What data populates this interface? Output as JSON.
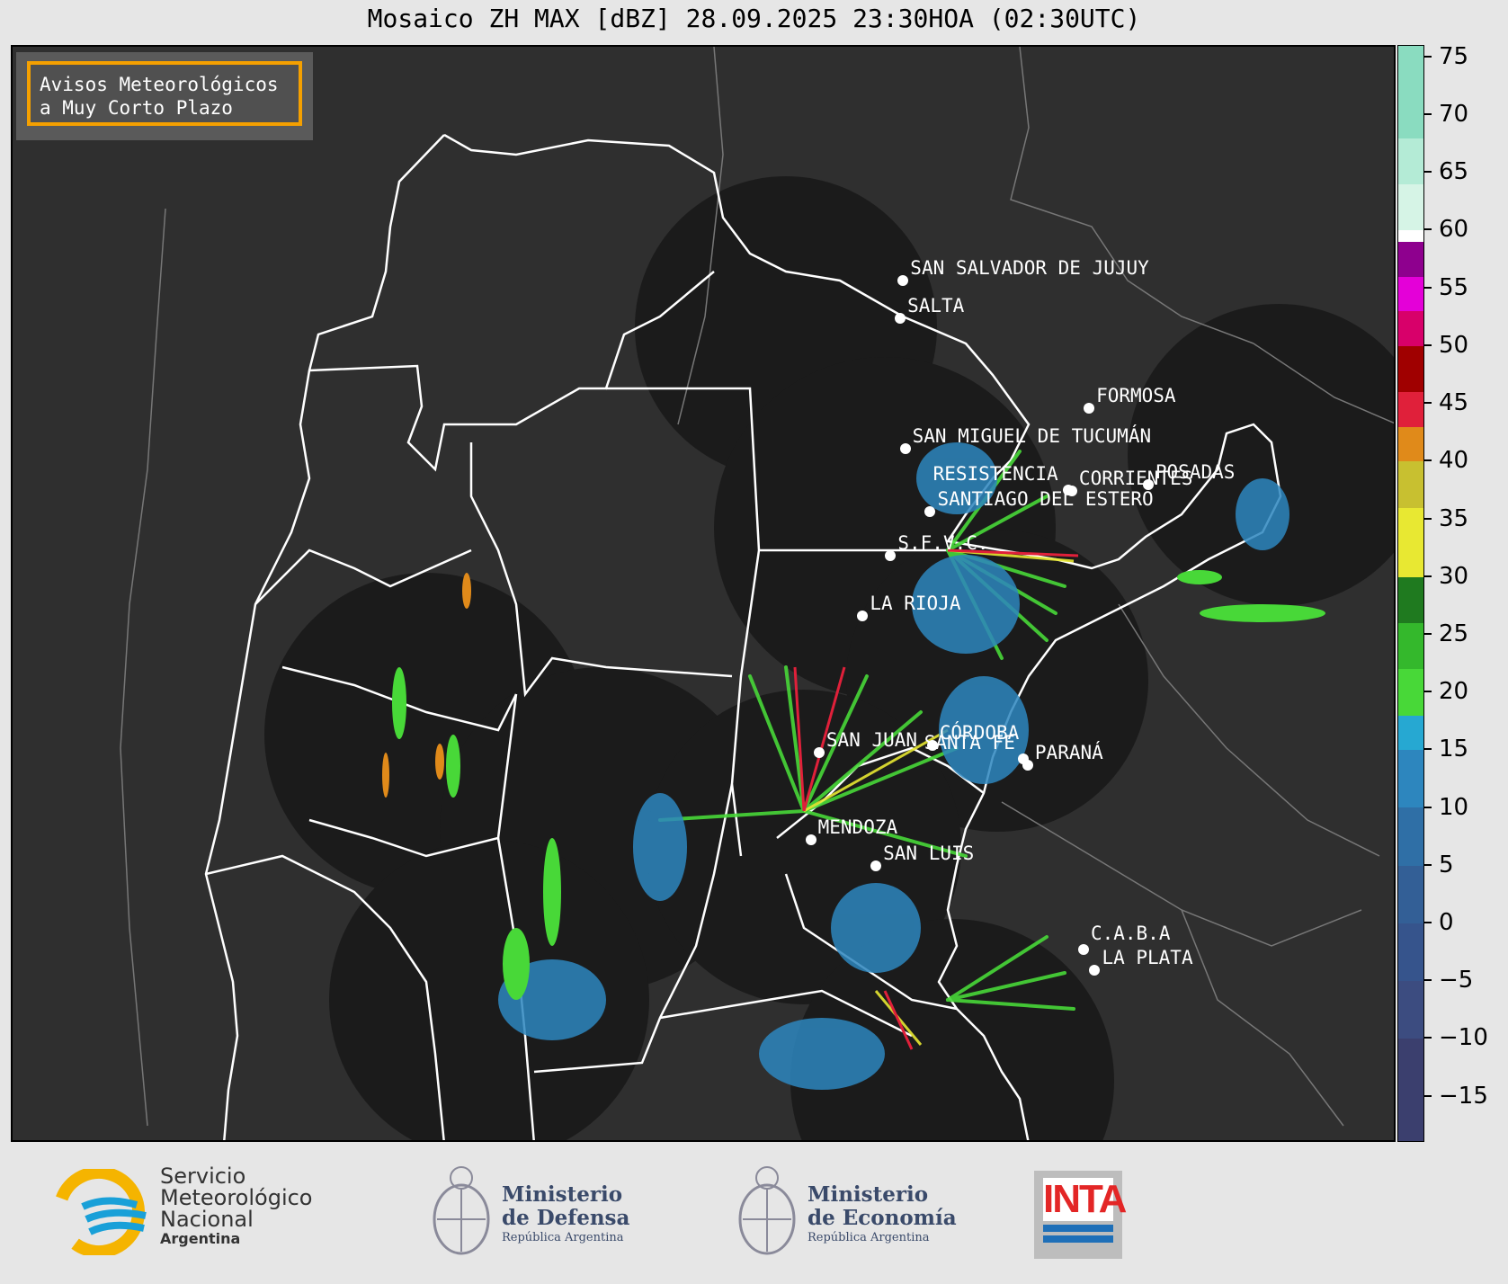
{
  "title": "Mosaico ZH MAX [dBZ] 28.09.2025 23:30HOA (02:30UTC)",
  "badge": {
    "line1": "Avisos Meteorológicos",
    "line2": "a Muy Corto Plazo"
  },
  "cities": [
    {
      "name": "SAN SALVADOR DE JUJUY",
      "lon": -65.3,
      "lat": -24.19
    },
    {
      "name": "SALTA",
      "lon": -65.41,
      "lat": -24.79
    },
    {
      "name": "SAN MIGUEL DE TUCUMÁN",
      "lon": -65.22,
      "lat": -26.81
    },
    {
      "name": "SANTIAGO DEL ESTERO",
      "lon": -64.26,
      "lat": -27.79
    },
    {
      "name": "FORMOSA",
      "lon": -58.17,
      "lat": -26.18
    },
    {
      "name": "RESISTENCIA",
      "lon": -58.98,
      "lat": -27.45
    },
    {
      "name": "CORRIENTES",
      "lon": -58.83,
      "lat": -27.47
    },
    {
      "name": "POSADAS",
      "lon": -55.9,
      "lat": -27.37
    },
    {
      "name": "S.F.V.C.",
      "lon": -65.78,
      "lat": -28.47
    },
    {
      "name": "LA RIOJA",
      "lon": -66.85,
      "lat": -29.41
    },
    {
      "name": "CÓRDOBA",
      "lon": -64.18,
      "lat": -31.42
    },
    {
      "name": "SANTA FE",
      "lon": -60.7,
      "lat": -31.63
    },
    {
      "name": "PARANÁ",
      "lon": -60.52,
      "lat": -31.73
    },
    {
      "name": "SAN JUAN",
      "lon": -68.52,
      "lat": -31.54
    },
    {
      "name": "MENDOZA",
      "lon": -68.84,
      "lat": -32.89
    },
    {
      "name": "SAN LUIS",
      "lon": -66.34,
      "lat": -33.3
    },
    {
      "name": "C.A.B.A",
      "lon": -58.38,
      "lat": -34.6
    },
    {
      "name": "LA PLATA",
      "lon": -57.95,
      "lat": -34.92
    }
  ],
  "colorbar": {
    "label": "dBZ",
    "min": -19,
    "max": 76,
    "ticks": [
      "75",
      "70",
      "65",
      "60",
      "55",
      "50",
      "45",
      "40",
      "35",
      "30",
      "25",
      "20",
      "15",
      "10",
      "5",
      "0",
      "−5",
      "−10",
      "−15"
    ],
    "tick_values": [
      75,
      70,
      65,
      60,
      55,
      50,
      45,
      40,
      35,
      30,
      25,
      20,
      15,
      10,
      5,
      0,
      -5,
      -10,
      -15
    ],
    "bands": [
      {
        "from": -19,
        "to": -10,
        "color": "#3b3f6e"
      },
      {
        "from": -10,
        "to": -5,
        "color": "#3c4c80"
      },
      {
        "from": -5,
        "to": 0,
        "color": "#36548c"
      },
      {
        "from": 0,
        "to": 5,
        "color": "#335f96"
      },
      {
        "from": 5,
        "to": 10,
        "color": "#2f6fa6"
      },
      {
        "from": 10,
        "to": 15,
        "color": "#2d86be"
      },
      {
        "from": 15,
        "to": 18,
        "color": "#26a8d2"
      },
      {
        "from": 18,
        "to": 22,
        "color": "#48d838"
      },
      {
        "from": 22,
        "to": 26,
        "color": "#34b82c"
      },
      {
        "from": 26,
        "to": 30,
        "color": "#1f7a1f"
      },
      {
        "from": 30,
        "to": 36,
        "color": "#e8e832"
      },
      {
        "from": 36,
        "to": 40,
        "color": "#c8c030"
      },
      {
        "from": 40,
        "to": 43,
        "color": "#e08a1a"
      },
      {
        "from": 43,
        "to": 46,
        "color": "#e0203a"
      },
      {
        "from": 46,
        "to": 50,
        "color": "#a00000"
      },
      {
        "from": 50,
        "to": 53,
        "color": "#d8006a"
      },
      {
        "from": 53,
        "to": 56,
        "color": "#e400d8"
      },
      {
        "from": 56,
        "to": 59,
        "color": "#8e008e"
      },
      {
        "from": 59,
        "to": 60,
        "color": "#ffffff"
      },
      {
        "from": 60,
        "to": 64,
        "color": "#d6f4e6"
      },
      {
        "from": 64,
        "to": 68,
        "color": "#b4ebd6"
      },
      {
        "from": 68,
        "to": 76,
        "color": "#8adcc0"
      }
    ]
  },
  "logos": {
    "smn": {
      "line1": "Servicio",
      "line2": "Meteorológico",
      "line3": "Nacional",
      "line4": "Argentina"
    },
    "defensa": {
      "line1": "Ministerio",
      "line2": "de Defensa",
      "line3": "República Argentina"
    },
    "economia": {
      "line1": "Ministerio",
      "line2": "de Economía",
      "line3": "República Argentina"
    },
    "inta": {
      "text": "INTA"
    }
  },
  "colors": {
    "map_bg": "#2f2f2f",
    "radar_disc": "#1b1b1b",
    "borders": "#ffffff",
    "accent": "#f5a000"
  }
}
